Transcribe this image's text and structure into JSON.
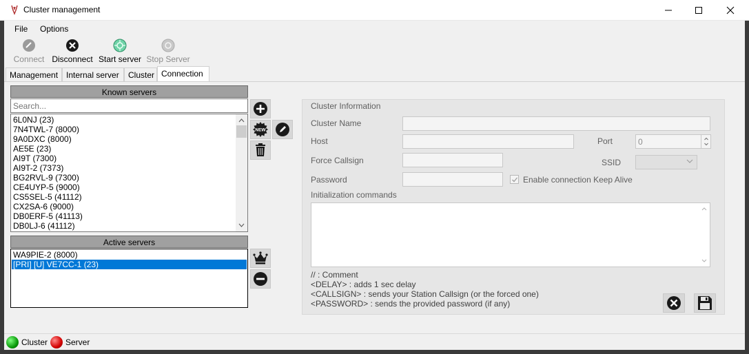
{
  "window": {
    "title": "Cluster management"
  },
  "menu": {
    "file": "File",
    "options": "Options"
  },
  "toolbar": {
    "connect": "Connect",
    "disconnect": "Disconnect",
    "start_server": "Start server",
    "stop_server": "Stop Server"
  },
  "tabs": {
    "management": "Management",
    "internal_server": "Internal server",
    "cluster": "Cluster",
    "connection": "Connection"
  },
  "known_servers": {
    "header": "Known servers",
    "search_placeholder": "Search...",
    "items": [
      "6L0NJ (23)",
      "7N4TWL-7 (8000)",
      "9A0DXC (8000)",
      "AE5E (23)",
      "AI9T (7300)",
      "AI9T-2 (7373)",
      "BG2RVL-9 (7300)",
      "CE4UYP-5 (9000)",
      "CS5SEL-5 (41112)",
      "CX2SA-6 (9000)",
      "DB0ERF-5 (41113)",
      "DB0LJ-6 (41112)"
    ]
  },
  "active_servers": {
    "header": "Active servers",
    "items": [
      "WA9PIE-2 (8000)",
      "[PRI] [U] VE7CC-1 (23)"
    ],
    "selected_index": 1
  },
  "cluster_info": {
    "group_title": "Cluster Information",
    "name_label": "Cluster Name",
    "host_label": "Host",
    "port_label": "Port",
    "port_value": "0",
    "force_callsign_label": "Force Callsign",
    "ssid_label": "SSID",
    "password_label": "Password",
    "keepalive_label": "Enable connection Keep Alive",
    "keepalive_checked": true,
    "init_label": "Initialization commands",
    "help": [
      "// : Comment",
      "<DELAY> : adds 1 sec delay",
      "<CALLSIGN> : sends your Station Callsign (or the forced one)",
      "<PASSWORD> : sends the provided password (if any)"
    ]
  },
  "status": {
    "cluster": "Cluster",
    "server": "Server",
    "cluster_color": "#0a9a0a",
    "server_color": "#d40000"
  }
}
